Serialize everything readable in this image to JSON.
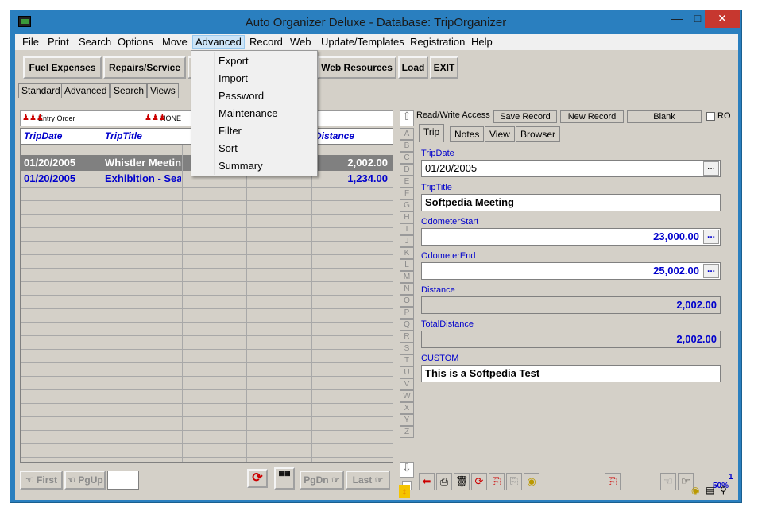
{
  "window": {
    "title": "Auto Organizer Deluxe - Database: TripOrganizer"
  },
  "menubar": {
    "items": [
      "File",
      "Print",
      "Search",
      "Options",
      "Move",
      "Advanced",
      "Record",
      "Web",
      "Update/Templates",
      "Registration",
      "Help"
    ]
  },
  "toolbar": {
    "buttons": [
      "Fuel Expenses",
      "Repairs/Service",
      "Web Resources",
      "Load",
      "EXIT"
    ]
  },
  "subtabs": [
    "Standard",
    "Advanced",
    "Search",
    "Views"
  ],
  "sortbar": {
    "first": "Entry Order",
    "second": "NONE"
  },
  "grid": {
    "headers": [
      "TripDate",
      "TripTitle",
      "Distance"
    ],
    "rows": [
      {
        "date": "01/20/2005",
        "title": "Whistler Meetin",
        "distance": "2,002.00"
      },
      {
        "date": "01/20/2005",
        "title": "Exhibition - Sea",
        "distance": "1,234.00"
      }
    ]
  },
  "navbar": {
    "first": "First",
    "pgup": "PgUp",
    "pgdn": "PgDn",
    "last": "Last"
  },
  "alphabet": [
    "A",
    "B",
    "C",
    "D",
    "E",
    "F",
    "G",
    "H",
    "I",
    "J",
    "K",
    "L",
    "M",
    "N",
    "O",
    "P",
    "Q",
    "R",
    "S",
    "T",
    "U",
    "V",
    "W",
    "X",
    "Y",
    "Z"
  ],
  "record": {
    "access": "Read/Write Access",
    "save": "Save Record",
    "new": "New Record",
    "blank": "Blank",
    "ro": "RO",
    "tabs": [
      "Trip",
      "Notes",
      "View",
      "Browser"
    ],
    "fields": [
      {
        "label": "TripDate",
        "value": "01/20/2005"
      },
      {
        "label": "TripTitle",
        "value": "Softpedia Meeting"
      },
      {
        "label": "OdometerStart",
        "value": "23,000.00"
      },
      {
        "label": "OdometerEnd",
        "value": "25,002.00"
      },
      {
        "label": "Distance",
        "value": "2,002.00"
      },
      {
        "label": "TotalDistance",
        "value": "2,002.00"
      },
      {
        "label": "CUSTOM",
        "value": "This is a Softpedia Test"
      }
    ],
    "counter": "1",
    "zoom": "50%"
  },
  "advanced_menu": {
    "items": [
      "Export",
      "Import",
      "Password",
      "Maintenance",
      "Filter",
      "Sort",
      "Summary"
    ]
  },
  "colors": {
    "titlebar": "#2a7fbf",
    "close": "#c7372f",
    "value_blue": "#0000cc"
  }
}
